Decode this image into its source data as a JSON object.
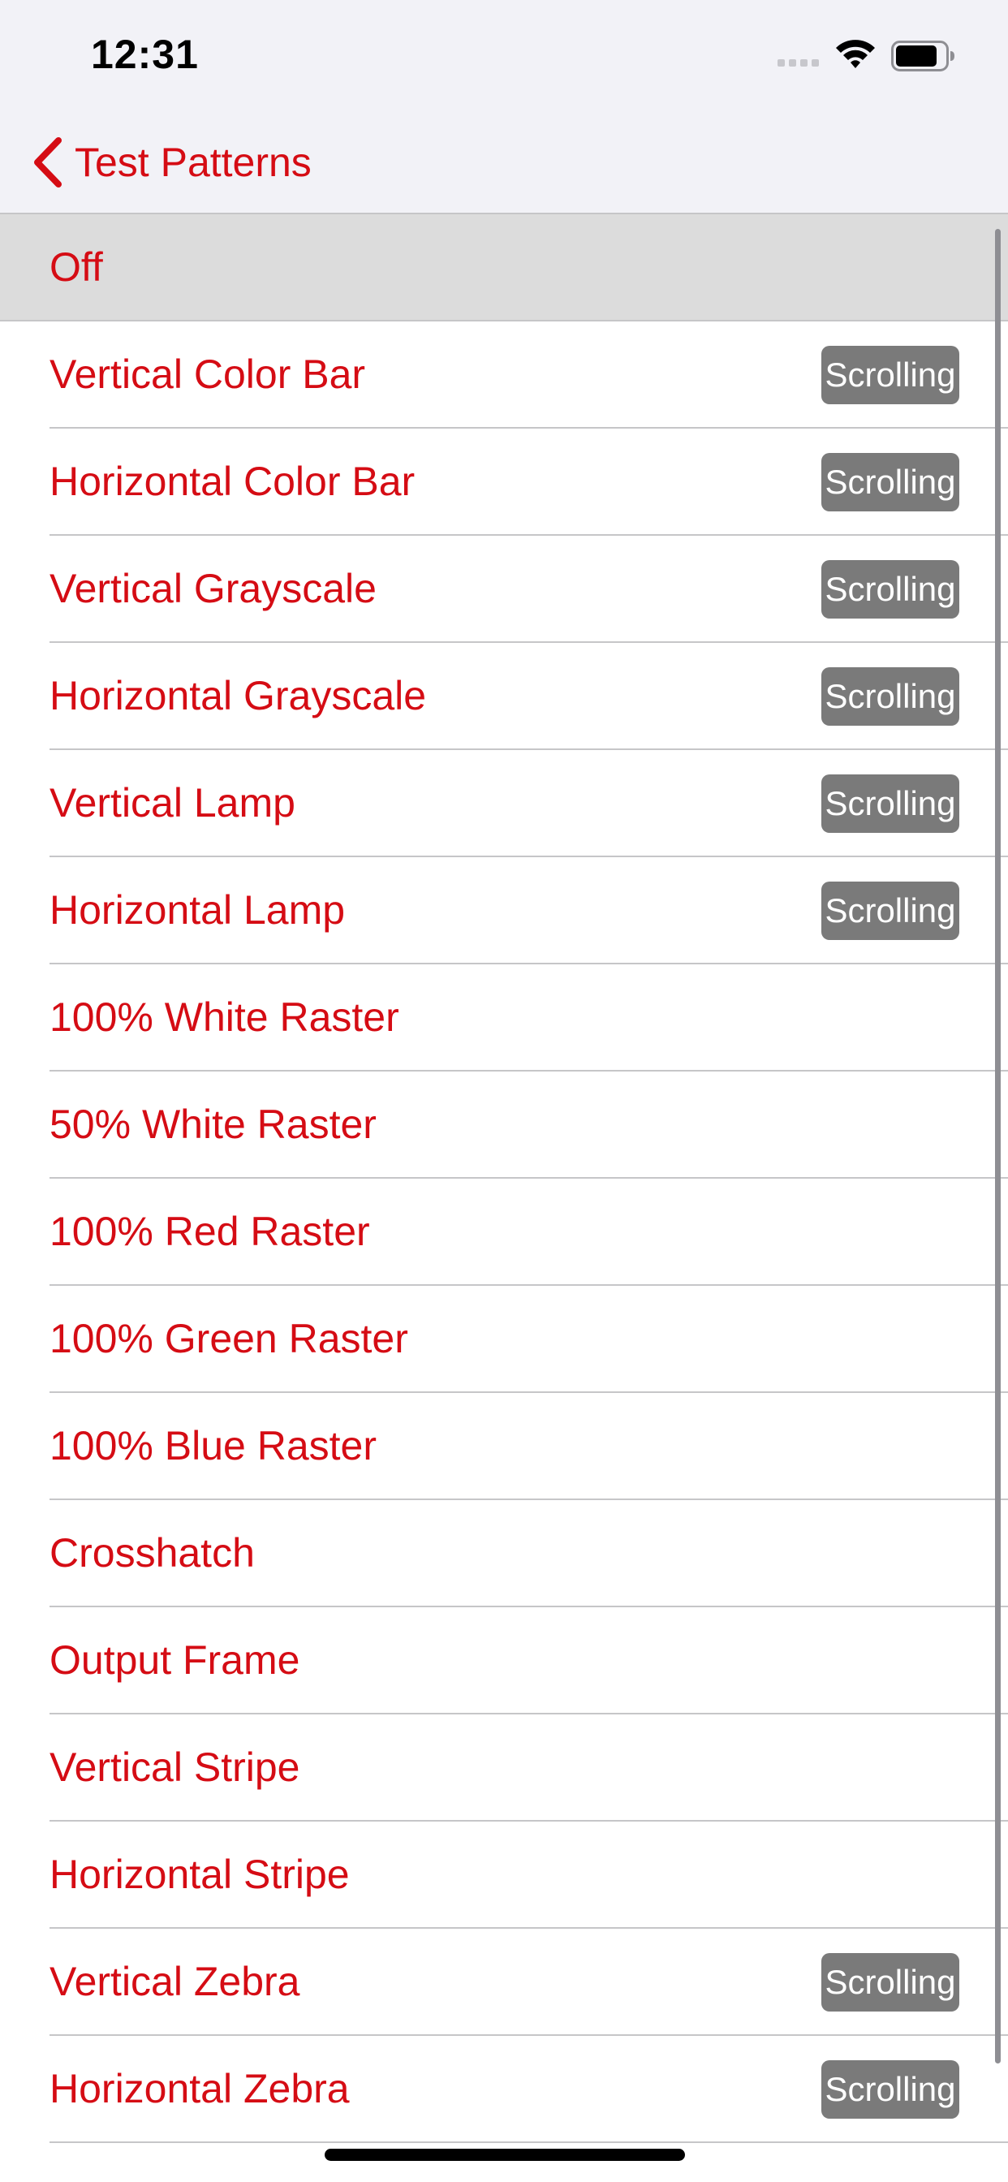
{
  "status_bar": {
    "time": "12:31",
    "icons": [
      "cellular-signal-icon",
      "wifi-icon",
      "battery-icon"
    ]
  },
  "nav": {
    "back_label": "Test Patterns",
    "back_icon": "chevron-left-icon"
  },
  "colors": {
    "accent": "#d50c14",
    "badge_bg": "#7a7a7a",
    "selected_row_bg": "#dcdcdc",
    "chrome_bg": "#f2f2f7"
  },
  "patterns": [
    {
      "label": "Off",
      "badge": "",
      "selected": true
    },
    {
      "label": "Vertical Color Bar",
      "badge": "Scrolling"
    },
    {
      "label": "Horizontal Color Bar",
      "badge": "Scrolling"
    },
    {
      "label": "Vertical Grayscale",
      "badge": "Scrolling"
    },
    {
      "label": "Horizontal Grayscale",
      "badge": "Scrolling"
    },
    {
      "label": "Vertical Lamp",
      "badge": "Scrolling"
    },
    {
      "label": "Horizontal Lamp",
      "badge": "Scrolling"
    },
    {
      "label": "100% White Raster",
      "badge": ""
    },
    {
      "label": "50% White Raster",
      "badge": ""
    },
    {
      "label": "100% Red Raster",
      "badge": ""
    },
    {
      "label": "100% Green Raster",
      "badge": ""
    },
    {
      "label": "100% Blue Raster",
      "badge": ""
    },
    {
      "label": "Crosshatch",
      "badge": ""
    },
    {
      "label": "Output Frame",
      "badge": ""
    },
    {
      "label": "Vertical Stripe",
      "badge": ""
    },
    {
      "label": "Horizontal Stripe",
      "badge": ""
    },
    {
      "label": "Vertical Zebra",
      "badge": "Scrolling"
    },
    {
      "label": "Horizontal Zebra",
      "badge": "Scrolling"
    }
  ]
}
